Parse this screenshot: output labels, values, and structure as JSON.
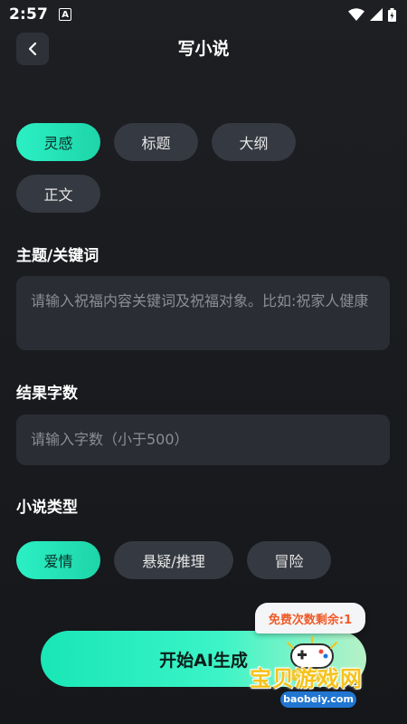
{
  "status_bar": {
    "time": "2:57",
    "notification_badge": "A",
    "icons": [
      "wifi-icon",
      "signal-icon",
      "battery-icon"
    ]
  },
  "header": {
    "title": "写小说",
    "back_icon": "chevron-left-icon"
  },
  "mode_tabs": [
    {
      "label": "灵感",
      "selected": true
    },
    {
      "label": "标题",
      "selected": false
    },
    {
      "label": "大纲",
      "selected": false
    },
    {
      "label": "正文",
      "selected": false
    }
  ],
  "topic": {
    "label": "主题/关键词",
    "placeholder": "请输入祝福内容关键词及祝福对象。比如:祝家人健康"
  },
  "word_count": {
    "label": "结果字数",
    "placeholder": "请输入字数（小于500）"
  },
  "novel_type": {
    "label": "小说类型",
    "options": [
      {
        "label": "爱情",
        "selected": true
      },
      {
        "label": "悬疑/推理",
        "selected": false
      },
      {
        "label": "冒险",
        "selected": false
      }
    ]
  },
  "generate": {
    "label": "开始AI生成",
    "free_remaining_text": "免费次数剩余:1"
  },
  "watermark": {
    "text": "宝贝游戏网",
    "url": "baobeiy.com"
  },
  "colors": {
    "accent": "#2bf0c4",
    "background": "#1b1d21",
    "chip": "#353941",
    "input": "#2a2d33",
    "badge_text": "#f05a28"
  }
}
